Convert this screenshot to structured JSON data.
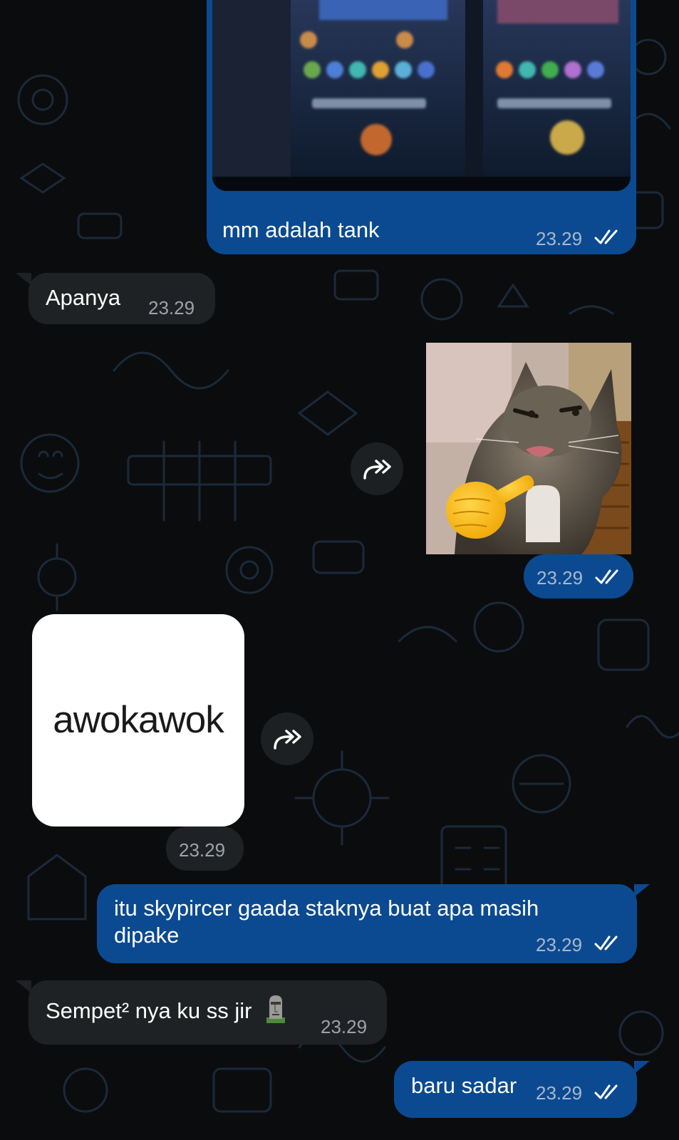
{
  "colors": {
    "background": "#0b0c0e",
    "outgoing_bubble": "#0b4a91",
    "incoming_bubble": "#1f2225",
    "read_ticks": "#ffffff"
  },
  "messages": [
    {
      "id": "m1",
      "direction": "outgoing",
      "type": "image_with_caption",
      "image": "mobile-legends-match-history-screenshot",
      "caption": "mm adalah tank",
      "time": "23.29",
      "status_icon": "double-check-icon"
    },
    {
      "id": "m2",
      "direction": "incoming",
      "type": "text",
      "text": "Apanya",
      "time": "23.29"
    },
    {
      "id": "m3",
      "direction": "outgoing",
      "type": "sticker",
      "image": "angry-cat-pointing-finger-sticker",
      "time": "23.29",
      "status_icon": "double-check-icon",
      "action_icon": "forward-icon"
    },
    {
      "id": "m4",
      "direction": "incoming",
      "type": "sticker",
      "sticker_text": "awokawok",
      "time": "23.29",
      "action_icon": "forward-icon"
    },
    {
      "id": "m5",
      "direction": "outgoing",
      "type": "text",
      "text_line1": "itu skypircer gaada staknya buat apa masih",
      "text_line2": "dipake",
      "time": "23.29",
      "status_icon": "double-check-icon"
    },
    {
      "id": "m6",
      "direction": "incoming",
      "type": "text",
      "text": "Sempet² nya ku ss jir",
      "emoji": "moai-emoji",
      "time": "23.29"
    },
    {
      "id": "m7",
      "direction": "outgoing",
      "type": "text",
      "text": "baru sadar",
      "time": "23.29",
      "status_icon": "double-check-icon"
    }
  ]
}
